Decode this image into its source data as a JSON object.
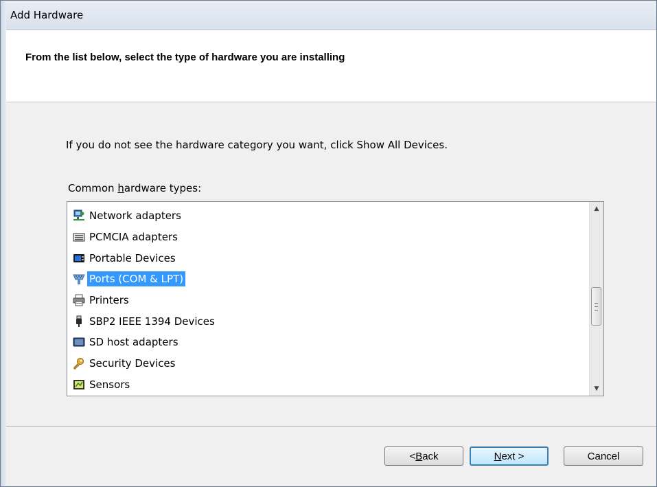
{
  "window": {
    "title": "Add Hardware"
  },
  "header": {
    "text": "From the list below, select the type of hardware you are installing"
  },
  "info_text": "If you do not see the hardware category you want, click Show All Devices.",
  "list": {
    "label_prefix": "Common ",
    "label_accel": "h",
    "label_suffix": "ardware types:",
    "items": [
      {
        "label": "Network adapters",
        "icon": "network-adapter-icon",
        "selected": false
      },
      {
        "label": "PCMCIA adapters",
        "icon": "pcmcia-icon",
        "selected": false
      },
      {
        "label": "Portable Devices",
        "icon": "portable-device-icon",
        "selected": false
      },
      {
        "label": "Ports (COM & LPT)",
        "icon": "port-icon",
        "selected": true
      },
      {
        "label": "Printers",
        "icon": "printer-icon",
        "selected": false
      },
      {
        "label": "SBP2 IEEE 1394 Devices",
        "icon": "usb-plug-icon",
        "selected": false
      },
      {
        "label": "SD host adapters",
        "icon": "sd-adapter-icon",
        "selected": false
      },
      {
        "label": "Security Devices",
        "icon": "key-icon",
        "selected": false
      },
      {
        "label": "Sensors",
        "icon": "sensor-icon",
        "selected": false
      }
    ],
    "selection_color": "#3399ff"
  },
  "buttons": {
    "back_prefix": "< ",
    "back_accel": "B",
    "back_suffix": "ack",
    "next_accel": "N",
    "next_suffix": "ext >",
    "cancel": "Cancel"
  }
}
